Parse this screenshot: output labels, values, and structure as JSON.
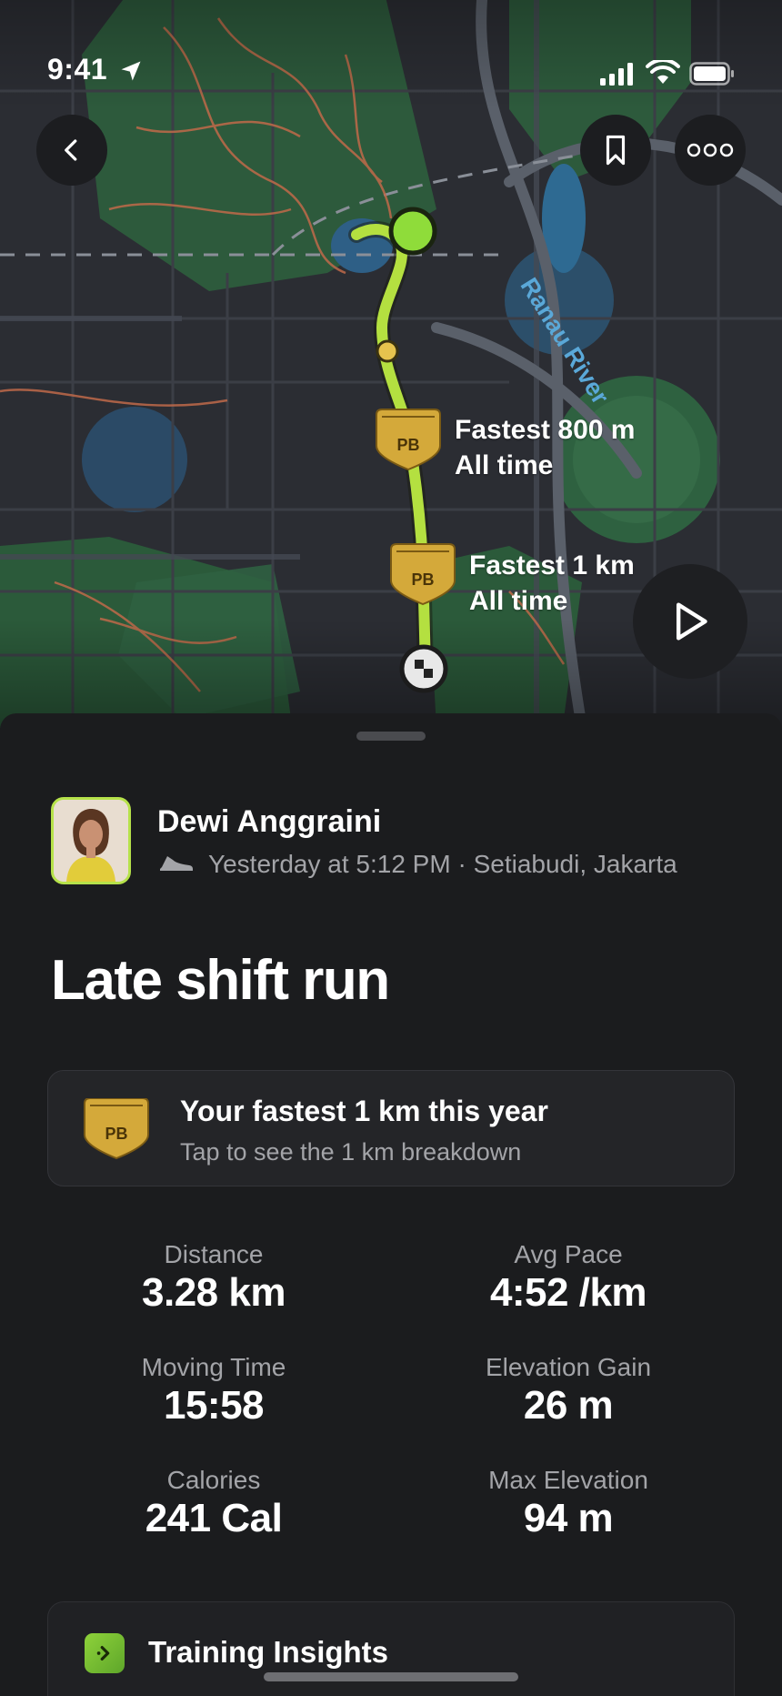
{
  "status_bar": {
    "time": "9:41"
  },
  "map": {
    "river_name": "Ranau River",
    "personal_bests": [
      {
        "badge": "PB",
        "title": "Fastest 800 m",
        "subtitle": "All time"
      },
      {
        "badge": "PB",
        "title": "Fastest 1 km",
        "subtitle": "All time"
      }
    ],
    "colors": {
      "route": "#b4e040",
      "start": "#8fdc3a",
      "water": "#2e6e8a",
      "park": "#2f5d3e",
      "trail": "#c06a4a"
    }
  },
  "toolbar": {
    "back_icon": "chevron-left-icon",
    "bookmark_icon": "bookmark-icon",
    "more_icon": "more-horizontal-icon",
    "play_icon": "play-icon"
  },
  "athlete": {
    "name": "Dewi Anggraini",
    "meta": "Yesterday at 5:12 PM · Setiabudi, Jakarta",
    "activity_icon": "running-shoe-icon"
  },
  "activity": {
    "title": "Late shift run"
  },
  "pb_card": {
    "badge": "PB",
    "title": "Your fastest 1 km this year",
    "subtitle": "Tap to see the 1 km breakdown"
  },
  "stats": [
    {
      "label": "Distance",
      "value": "3.28 km"
    },
    {
      "label": "Avg Pace",
      "value": "4:52 /km"
    },
    {
      "label": "Moving Time",
      "value": "15:58"
    },
    {
      "label": "Elevation Gain",
      "value": "26 m"
    },
    {
      "label": "Calories",
      "value": "241 Cal"
    },
    {
      "label": "Max Elevation",
      "value": "94 m"
    }
  ],
  "insights": {
    "title": "Training Insights",
    "icon": "insights-arrow-icon"
  }
}
